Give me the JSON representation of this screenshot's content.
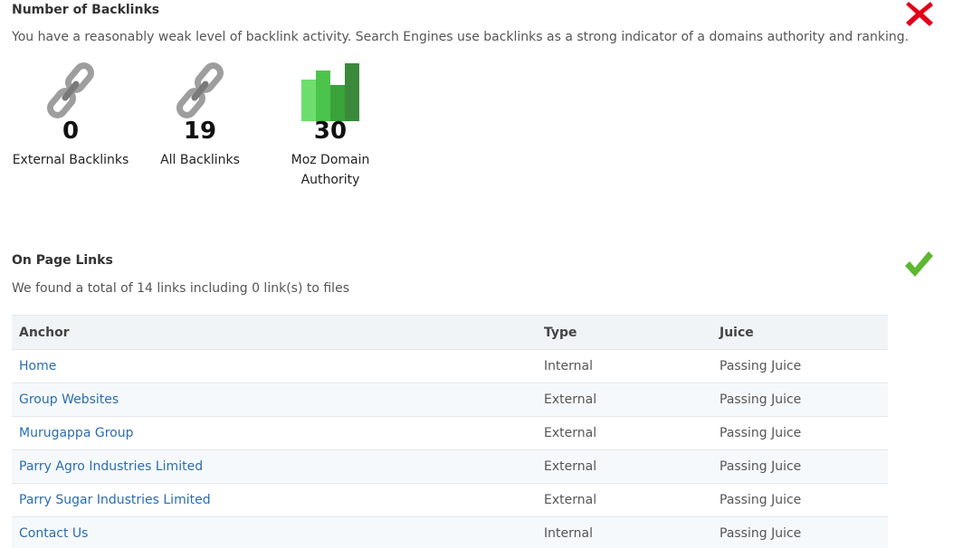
{
  "backlinks": {
    "title": "Number of Backlinks",
    "description": "You have a reasonably weak level of backlink activity. Search Engines use backlinks as a strong indicator of a domains authority and ranking.",
    "status_icon": "cross-icon",
    "status_color": "#e2001a",
    "stats": [
      {
        "icon": "chain-link-icon",
        "value": "0",
        "label": "External Backlinks"
      },
      {
        "icon": "chain-link-icon",
        "value": "19",
        "label": "All Backlinks"
      },
      {
        "icon": "bar-chart-icon",
        "value": "30",
        "label_line1": "Moz Domain",
        "label_line2": "Authority"
      }
    ]
  },
  "on_page_links": {
    "title": "On Page Links",
    "description": "We found a total of 14 links including 0 link(s) to files",
    "status_icon": "checkmark-icon",
    "status_color": "#5bb82f",
    "table": {
      "headers": [
        "Anchor",
        "Type",
        "Juice"
      ],
      "rows": [
        {
          "anchor": "Home",
          "type": "Internal",
          "juice": "Passing Juice"
        },
        {
          "anchor": "Group Websites",
          "type": "External",
          "juice": "Passing Juice"
        },
        {
          "anchor": "Murugappa Group",
          "type": "External",
          "juice": "Passing Juice"
        },
        {
          "anchor": "Parry Agro Industries Limited",
          "type": "External",
          "juice": "Passing Juice"
        },
        {
          "anchor": "Parry Sugar Industries Limited",
          "type": "External",
          "juice": "Passing Juice"
        },
        {
          "anchor": "Contact Us",
          "type": "Internal",
          "juice": "Passing Juice"
        }
      ]
    }
  }
}
